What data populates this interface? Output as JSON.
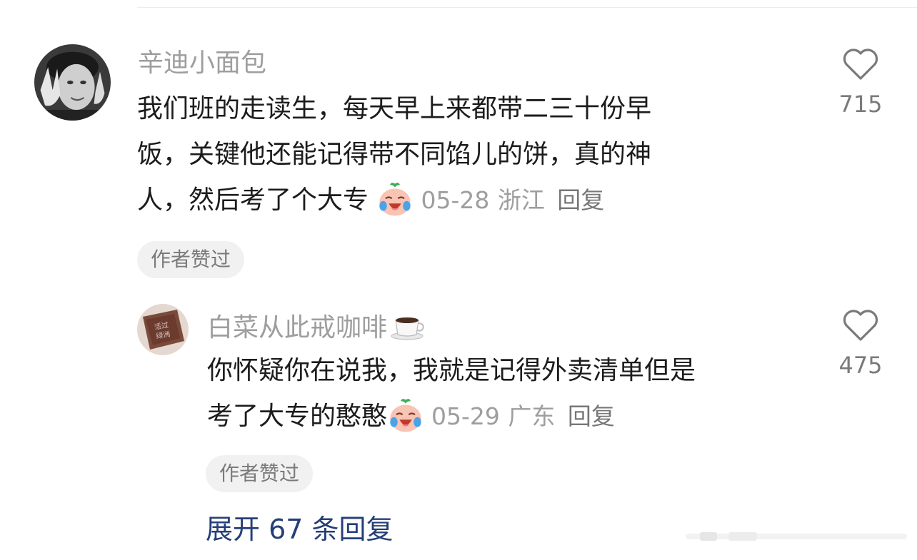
{
  "comment": {
    "username": "辛迪小面包",
    "text_lines": [
      "我们班的走读生，每天早上来都带二三十份早",
      "饭，关键他还能记得带不同馅儿的饼，真的神",
      "人，然后考了个大专"
    ],
    "emoji": "crying-laughing-emoji",
    "date": "05-28",
    "location": "浙江",
    "reply_label": "回复",
    "badge": "作者赞过",
    "like_count": "715"
  },
  "reply": {
    "username": "白菜从此戒咖啡",
    "username_icon": "coffee-cup-icon",
    "avatar_text": "活过 绿洲",
    "text_lines": [
      "你怀疑你在说我，我就是记得外卖清单但是",
      "考了大专的憨憨"
    ],
    "emoji": "crying-laughing-emoji",
    "date": "05-29",
    "location": "广东",
    "reply_label": "回复",
    "badge": "作者赞过",
    "like_count": "475"
  },
  "expand_replies": "展开 67 条回复",
  "colors": {
    "username": "#9e9e9e",
    "text": "#1c1c1c",
    "link": "#243f78",
    "badge_bg": "#f1f1f1"
  }
}
